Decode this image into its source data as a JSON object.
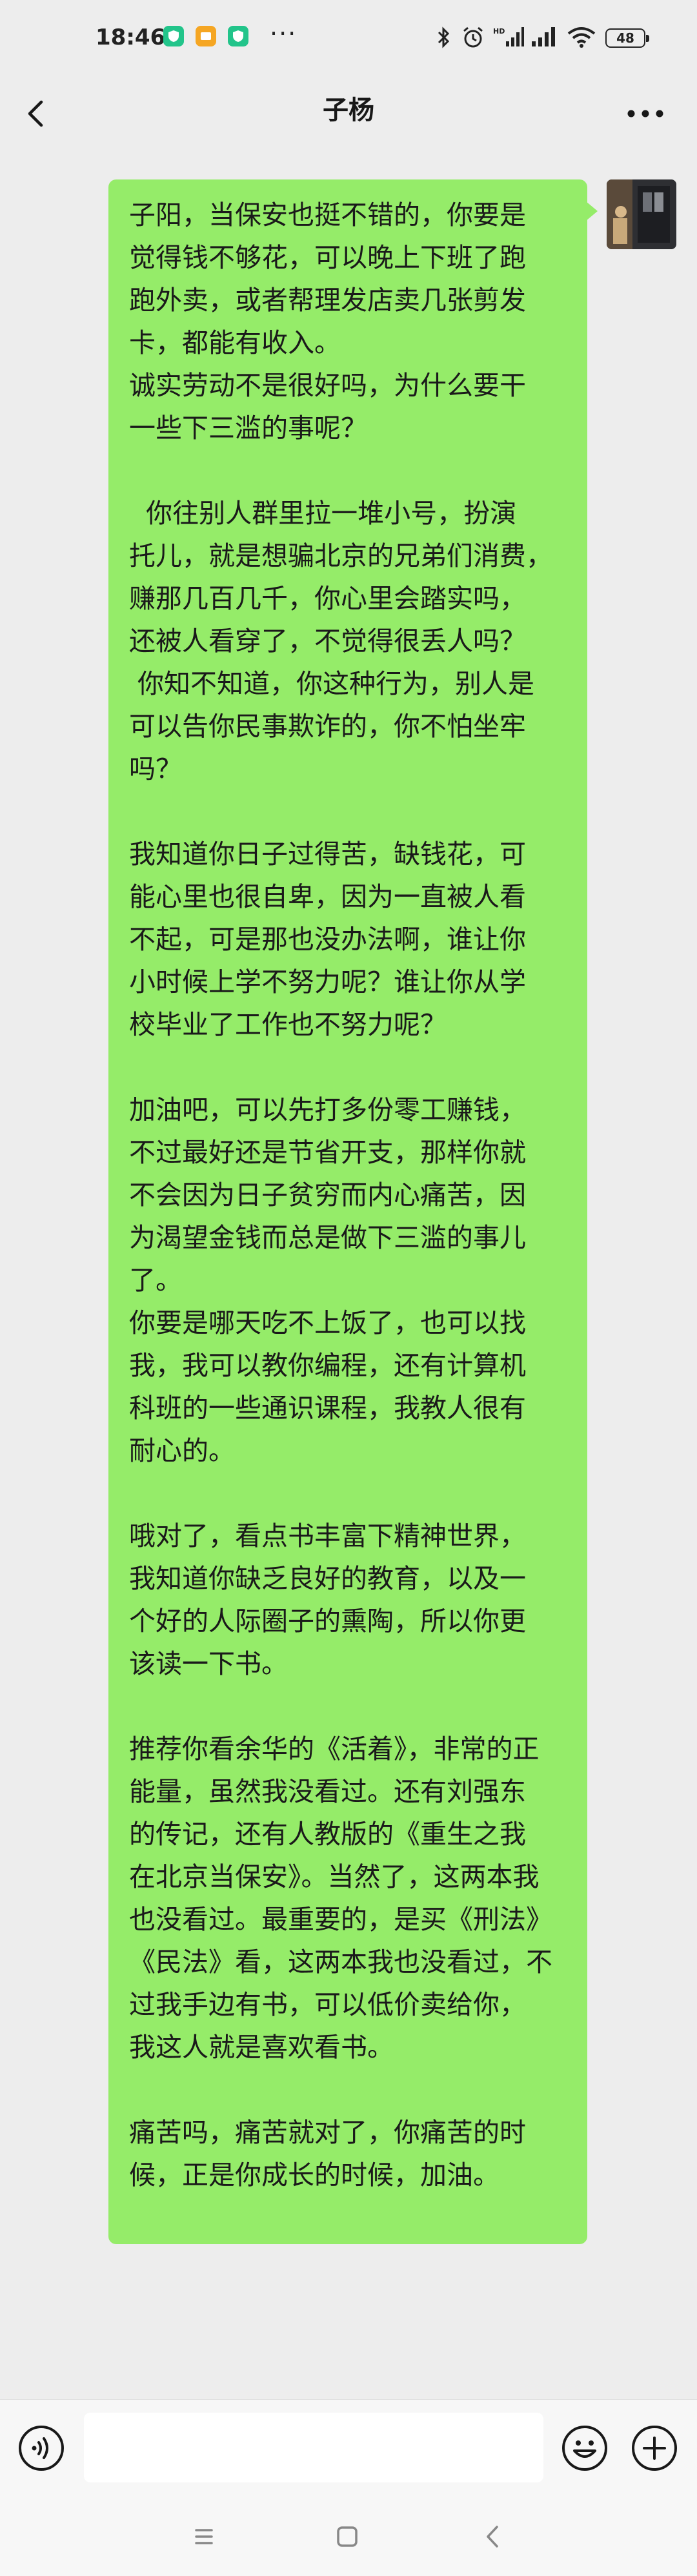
{
  "status_bar": {
    "time": "18:46",
    "dots": "···",
    "battery": "48",
    "icons": [
      "shield-app-icon",
      "folder-app-icon",
      "shield-app-icon",
      "bluetooth-icon",
      "alarm-icon",
      "hd-signal-icon",
      "signal-icon",
      "wifi-icon",
      "battery-icon"
    ]
  },
  "header": {
    "title": "子杨",
    "back_icon": "chevron-left-icon",
    "more_icon": "more-dots-icon"
  },
  "message": {
    "from": "self",
    "paragraphs": [
      [
        "子阳，当保安也挺不错的，你要是",
        "觉得钱不够花，可以晚上下班了跑",
        "跑外卖，或者帮理发店卖几张剪发",
        "卡，都能有收入。",
        "诚实劳动不是很好吗，为什么要干",
        "一些下三滥的事呢？"
      ],
      [
        "  你往别人群里拉一堆小号，扮演",
        "托儿，就是想骗北京的兄弟们消费，",
        "赚那几百几千，你心里会踏实吗，",
        "还被人看穿了，不觉得很丢人吗？",
        " 你知不知道，你这种行为，别人是",
        "可以告你民事欺诈的，你不怕坐牢",
        "吗？"
      ],
      [
        "我知道你日子过得苦，缺钱花，可",
        "能心里也很自卑，因为一直被人看",
        "不起，可是那也没办法啊，谁让你",
        "小时候上学不努力呢？谁让你从学",
        "校毕业了工作也不努力呢？"
      ],
      [
        "加油吧，可以先打多份零工赚钱，",
        "不过最好还是节省开支，那样你就",
        "不会因为日子贫穷而内心痛苦，因",
        "为渴望金钱而总是做下三滥的事儿",
        "了。",
        "你要是哪天吃不上饭了，也可以找",
        "我，我可以教你编程，还有计算机",
        "科班的一些通识课程，我教人很有",
        "耐心的。"
      ],
      [
        "哦对了，看点书丰富下精神世界，",
        "我知道你缺乏良好的教育，以及一",
        "个好的人际圈子的熏陶，所以你更",
        "该读一下书。"
      ],
      [
        "推荐你看余华的《活着》，非常的正",
        "能量，虽然我没看过。还有刘强东",
        "的传记，还有人教版的《重生之我",
        "在北京当保安》。当然了，这两本我",
        "也没看过。最重要的，是买《刑法》",
        "《民法》看，这两本我也没看过，不",
        "过我手边有书，可以低价卖给你，",
        "我这人就是喜欢看书。"
      ],
      [
        "痛苦吗，痛苦就对了，你痛苦的时",
        "候，正是你成长的时候，加油。"
      ]
    ]
  },
  "input_bar": {
    "placeholder": "",
    "voice_icon": "voice-icon",
    "emoji_icon": "emoji-icon",
    "plus_icon": "plus-icon"
  },
  "system_nav": [
    "menu-icon",
    "home-icon",
    "back-icon"
  ],
  "colors": {
    "bubble": "#95ec69",
    "background": "#ededed",
    "bar": "#f7f7f7"
  }
}
